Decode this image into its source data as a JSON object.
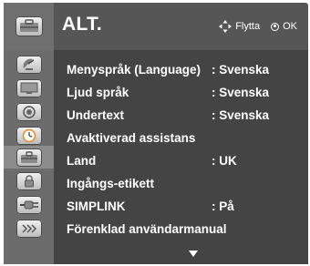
{
  "header": {
    "title": "ALT.",
    "hint_move": "Flytta",
    "hint_ok": "OK"
  },
  "categories": [
    {
      "icon": "satellite-dish-icon",
      "active": false
    },
    {
      "icon": "screen-icon",
      "active": false
    },
    {
      "icon": "speaker-icon",
      "active": false
    },
    {
      "icon": "clock-icon",
      "active": false
    },
    {
      "icon": "toolbox-icon",
      "active": true
    },
    {
      "icon": "lock-icon",
      "active": false
    },
    {
      "icon": "plug-icon",
      "active": false
    },
    {
      "icon": "guide-icon",
      "active": false
    }
  ],
  "menu": {
    "items": [
      {
        "label": "Menyspråk (Language)",
        "value": ": Svenska"
      },
      {
        "label": "Ljud språk",
        "value": ": Svenska"
      },
      {
        "label": "Undertext",
        "value": ": Svenska"
      },
      {
        "label": "Avaktiverad assistans",
        "value": ""
      },
      {
        "label": "Land",
        "value": ": UK"
      },
      {
        "label": "Ingångs-etikett",
        "value": ""
      },
      {
        "label": "SIMPLINK",
        "value": ": På"
      },
      {
        "label": "Förenklad användarmanual",
        "value": ""
      }
    ]
  },
  "colors": {
    "frame": "#565656",
    "panel": "#444444",
    "icon_column": "#6c6c6c",
    "text": "#ffffff"
  }
}
